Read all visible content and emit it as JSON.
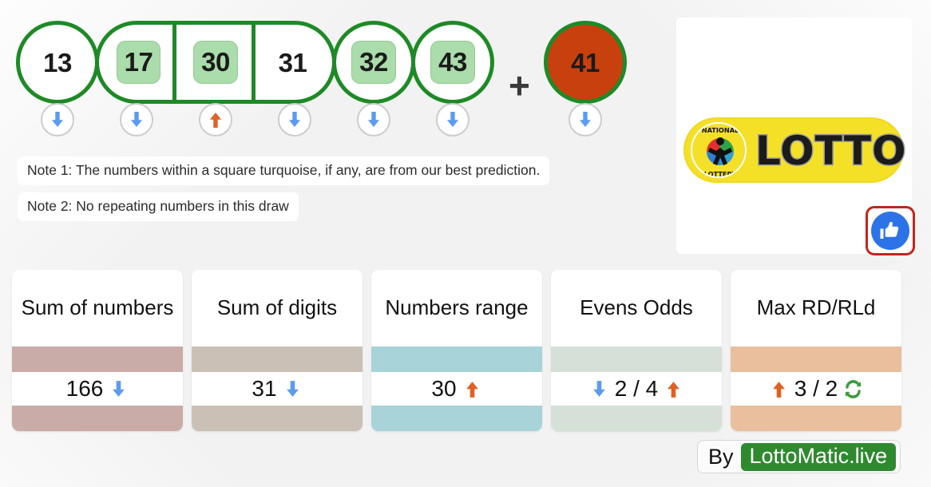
{
  "draw": {
    "main_balls": [
      {
        "number": "13",
        "predicted": false,
        "trend": "down",
        "group": null
      },
      {
        "number": "17",
        "predicted": true,
        "trend": "down",
        "group": "start"
      },
      {
        "number": "30",
        "predicted": true,
        "trend": "up",
        "group": "mid"
      },
      {
        "number": "31",
        "predicted": false,
        "trend": "down",
        "group": "end"
      },
      {
        "number": "32",
        "predicted": true,
        "trend": "down",
        "group": null
      },
      {
        "number": "43",
        "predicted": true,
        "trend": "down",
        "group": null
      }
    ],
    "separator": "+",
    "bonus_ball": {
      "number": "41",
      "trend": "down"
    }
  },
  "notes": {
    "note1": "Note 1: The numbers within a square turquoise, if any, are from our best prediction.",
    "note2": "Note 2: No repeating numbers in this draw"
  },
  "logo": {
    "emblem_top_text": "NATIONAL",
    "emblem_bottom_text": "LOTTERY",
    "wordmark": "LOTTO",
    "like_icon": "thumbs-up-icon"
  },
  "stats": [
    {
      "title": "Sum of numbers",
      "value": "166",
      "band_color": "#c9aca7",
      "icons_before": [],
      "icons_after": [
        "arrow-down-blue"
      ]
    },
    {
      "title": "Sum of digits",
      "value": "31",
      "band_color": "#cbc0b5",
      "icons_before": [],
      "icons_after": [
        "arrow-down-blue"
      ]
    },
    {
      "title": "Numbers range",
      "value": "30",
      "band_color": "#a8d3d9",
      "icons_before": [],
      "icons_after": [
        "arrow-up-orange"
      ]
    },
    {
      "title": "Evens Odds",
      "value": "2 / 4",
      "band_color": "#d5e0d8",
      "icons_before": [
        "arrow-down-blue"
      ],
      "icons_after": [
        "arrow-up-orange"
      ]
    },
    {
      "title": "Max RD/RLd",
      "value": "3 / 2",
      "band_color": "#e9bf9e",
      "icons_before": [
        "arrow-up-orange"
      ],
      "icons_after": [
        "refresh-green"
      ]
    }
  ],
  "footer": {
    "by_label": "By",
    "brand": "LottoMatic.live"
  },
  "colors": {
    "ball_border_green": "#1e8a26",
    "bonus_fill": "#c8400d",
    "prediction_square": "#abdcab",
    "arrow_down_blue": "#5b9bf0",
    "arrow_up_orange": "#df6126",
    "refresh_green": "#3d9b3d",
    "brand_green": "#2f8a2f",
    "logo_yellow": "#f5e028",
    "page_bg": "#f2f2f2"
  }
}
